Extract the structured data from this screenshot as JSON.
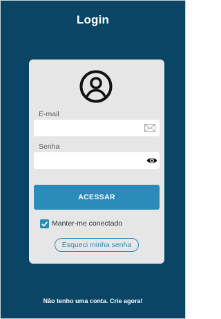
{
  "header": {
    "title": "Login"
  },
  "form": {
    "avatar_icon": "user-circle-icon",
    "email": {
      "label": "E-mail",
      "value": "",
      "placeholder": "",
      "icon": "envelope-icon"
    },
    "password": {
      "label": "Senha",
      "value": "",
      "placeholder": "",
      "icon": "eye-icon"
    },
    "submit_label": "ACESSAR",
    "keep_logged_in": {
      "label": "Manter-me conectado",
      "checked": true
    },
    "forgot_password_label": "Esqueci minha senha"
  },
  "footer": {
    "signup_label": "Não tenho uma conta. Crie agora!"
  },
  "colors": {
    "background": "#0b4566",
    "card": "#e6e6e6",
    "accent": "#2a8ab8",
    "text_light": "#ffffff"
  }
}
